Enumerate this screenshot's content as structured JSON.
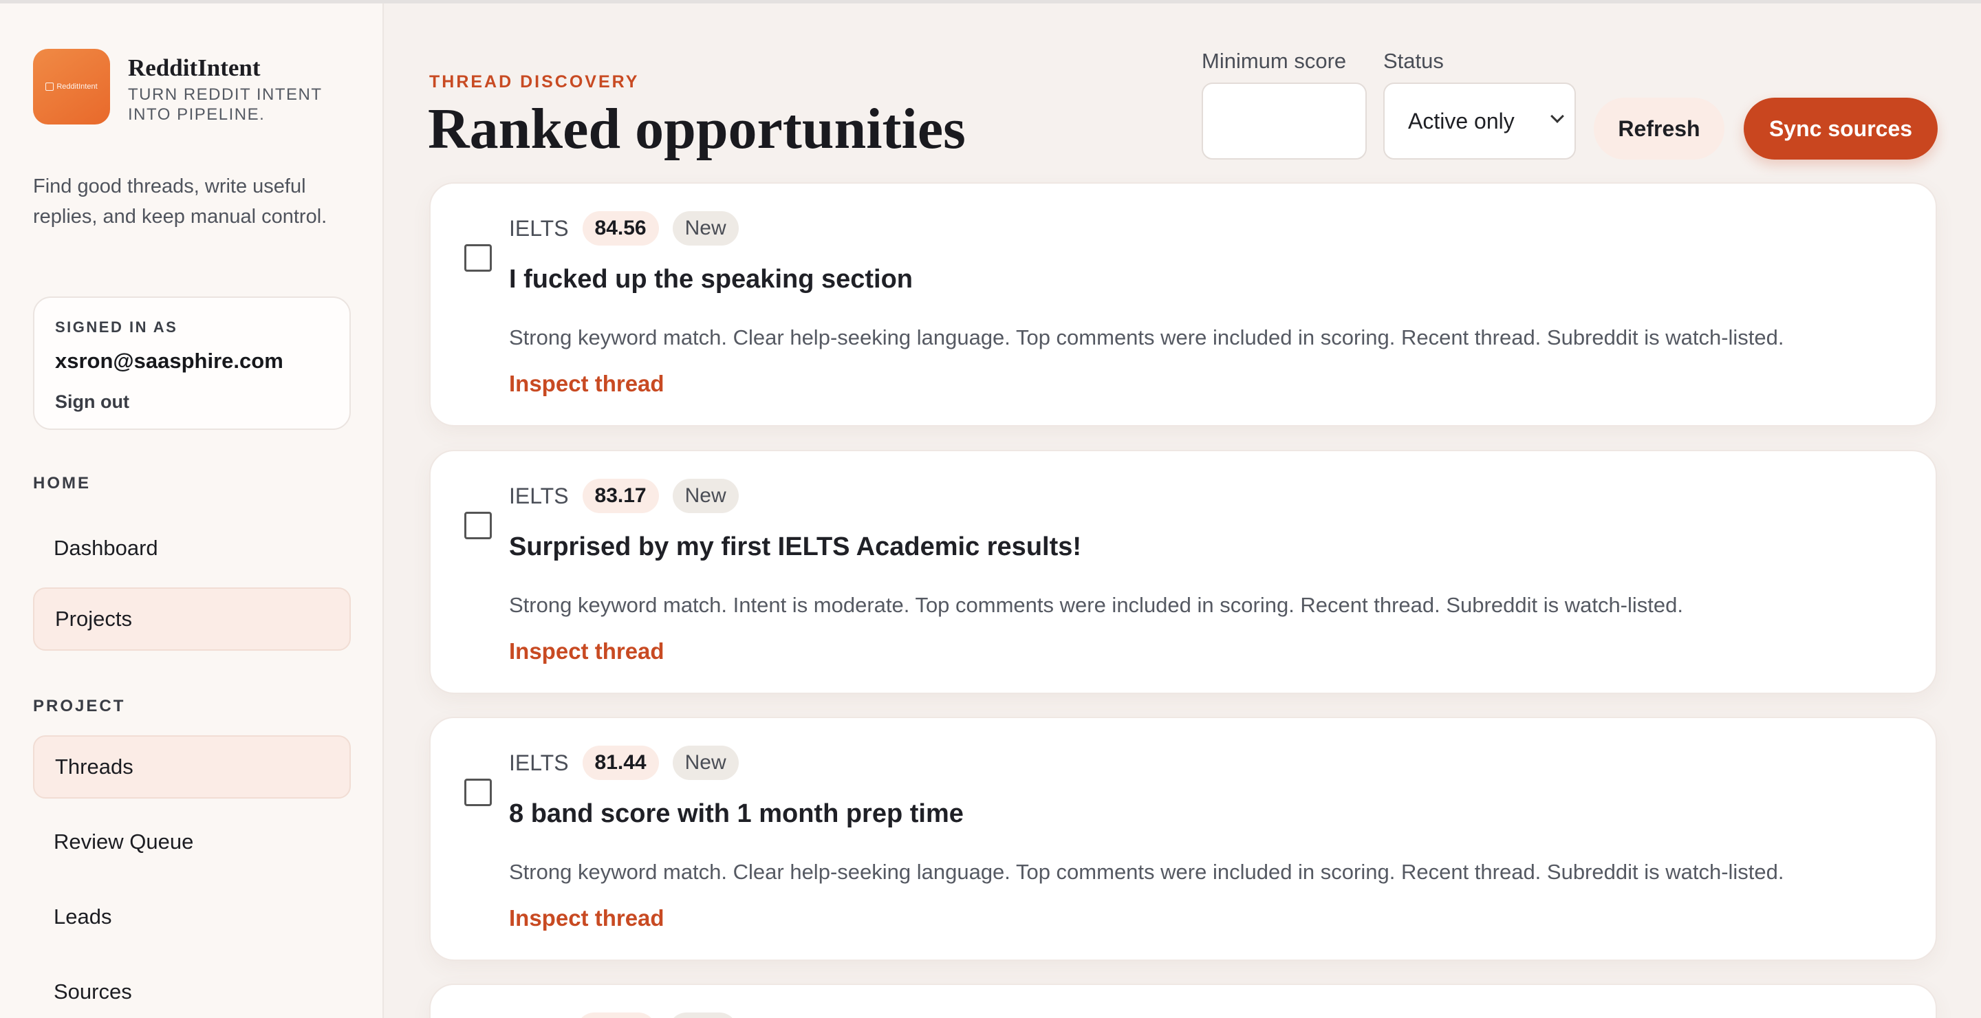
{
  "brand": {
    "name": "RedditIntent",
    "logo_text": "RedditIntent",
    "tagline": "TURN REDDIT INTENT INTO PIPELINE."
  },
  "sidebar": {
    "description": "Find good threads, write useful replies, and keep manual control.",
    "account": {
      "label": "SIGNED IN AS",
      "email": "xsron@saasphire.com",
      "signout": "Sign out"
    },
    "home_heading": "HOME",
    "home_items": [
      {
        "label": "Dashboard",
        "active": false
      },
      {
        "label": "Projects",
        "active": true
      }
    ],
    "project_heading": "PROJECT",
    "project_items": [
      {
        "label": "Threads",
        "active": true
      },
      {
        "label": "Review Queue",
        "active": false
      },
      {
        "label": "Leads",
        "active": false
      },
      {
        "label": "Sources",
        "active": false
      }
    ]
  },
  "header": {
    "eyebrow": "THREAD DISCOVERY",
    "title": "Ranked opportunities",
    "min_score_label": "Minimum score",
    "min_score_value": "",
    "status_label": "Status",
    "status_value": "Active only",
    "refresh_label": "Refresh",
    "sync_label": "Sync sources"
  },
  "threads": [
    {
      "subreddit": "IELTS",
      "score": "84.56",
      "status": "New",
      "title": "I fucked up the speaking section",
      "reasons": "Strong keyword match. Clear help-seeking language. Top comments were included in scoring. Recent thread. Subreddit is watch-listed.",
      "action": "Inspect thread"
    },
    {
      "subreddit": "IELTS",
      "score": "83.17",
      "status": "New",
      "title": "Surprised by my first IELTS Academic results!",
      "reasons": "Strong keyword match. Intent is moderate. Top comments were included in scoring. Recent thread. Subreddit is watch-listed.",
      "action": "Inspect thread"
    },
    {
      "subreddit": "IELTS",
      "score": "81.44",
      "status": "New",
      "title": "8 band score with 1 month prep time",
      "reasons": "Strong keyword match. Clear help-seeking language. Top comments were included in scoring. Recent thread. Subreddit is watch-listed.",
      "action": "Inspect thread"
    }
  ],
  "colors": {
    "accent": "#c9461f",
    "accent_soft": "#fbece6",
    "sidebar_bg": "#fbf7f4"
  }
}
